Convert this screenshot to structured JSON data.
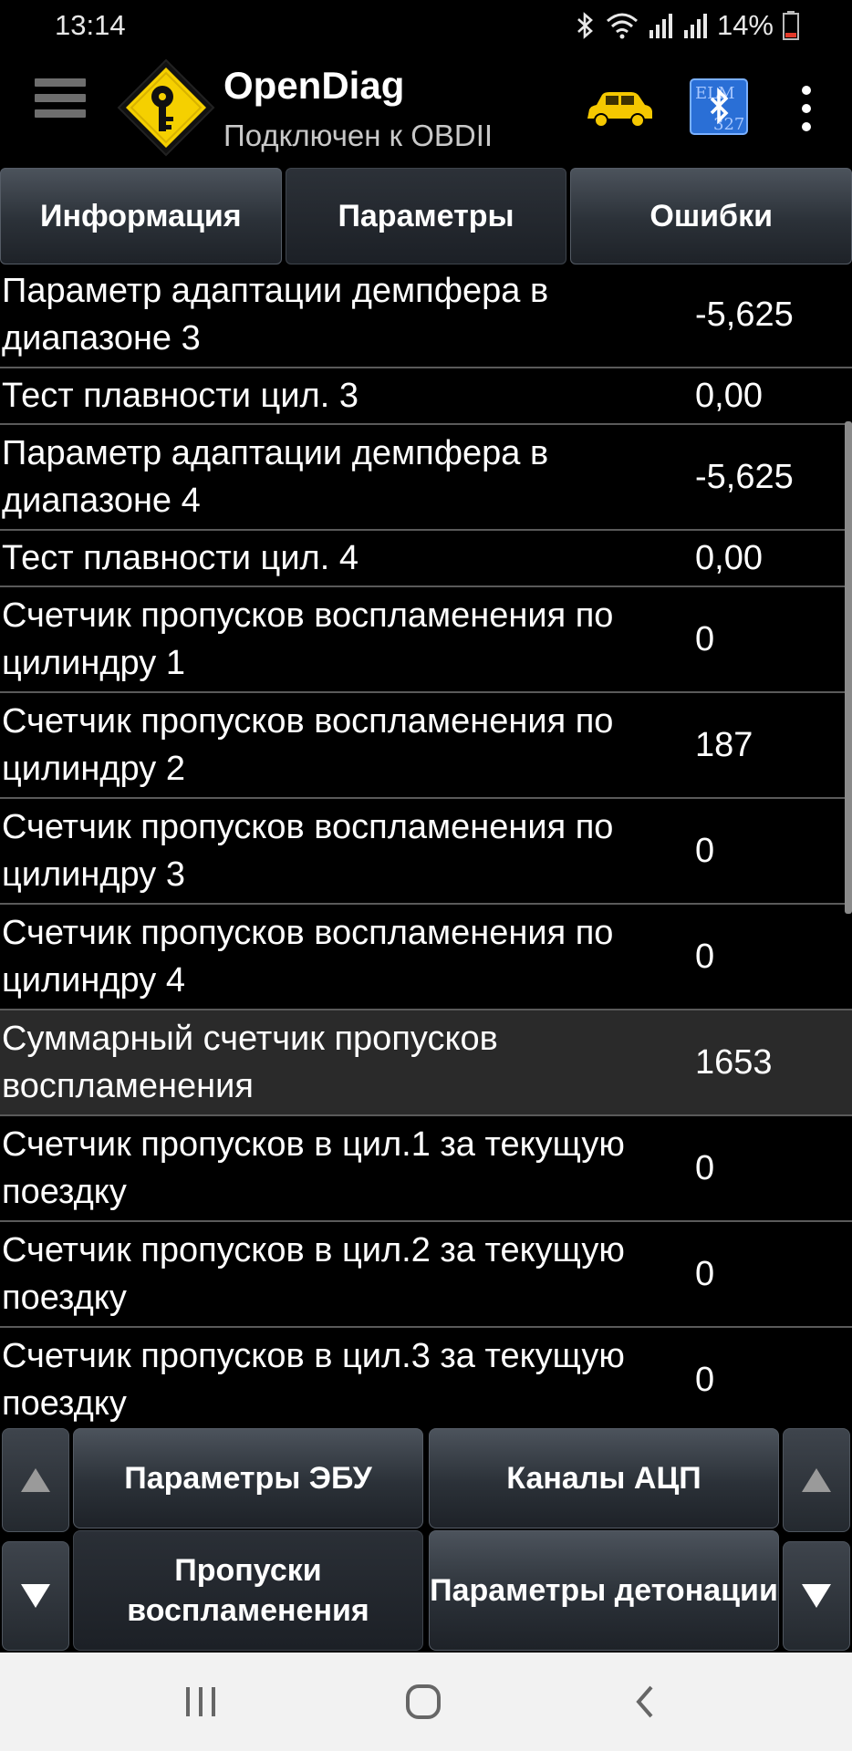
{
  "status_bar": {
    "time": "13:14",
    "battery": "14%"
  },
  "app": {
    "title": "OpenDiag",
    "subtitle": "Подключен к OBDII"
  },
  "tabs": [
    {
      "label": "Информация",
      "active": false
    },
    {
      "label": "Параметры",
      "active": true
    },
    {
      "label": "Ошибки",
      "active": false
    }
  ],
  "params": [
    {
      "name": "Параметр адаптации демпфера в диапазоне 3",
      "value": "-5,625"
    },
    {
      "name": "Тест плавности цил. 3",
      "value": "0,00"
    },
    {
      "name": "Параметр адаптации демпфера в диапазоне 4",
      "value": "-5,625"
    },
    {
      "name": "Тест плавности цил. 4",
      "value": "0,00"
    },
    {
      "name": "Счетчик пропусков воспламенения по цилиндру 1",
      "value": "0"
    },
    {
      "name": "Счетчик пропусков воспламенения по цилиндру 2",
      "value": "187"
    },
    {
      "name": "Счетчик пропусков воспламенения по цилиндру 3",
      "value": "0"
    },
    {
      "name": "Счетчик пропусков воспламенения по цилиндру 4",
      "value": "0"
    },
    {
      "name": "Суммарный счетчик пропусков воспламенения",
      "value": "1653"
    },
    {
      "name": "Счетчик пропусков в цил.1 за текущую поездку",
      "value": "0"
    },
    {
      "name": "Счетчик пропусков в цил.2 за текущую поездку",
      "value": "0"
    },
    {
      "name": "Счетчик пропусков в цил.3 за текущую поездку",
      "value": "0"
    }
  ],
  "bottom_buttons": {
    "ecu_params": "Параметры ЭБУ",
    "adc_channels": "Каналы АЦП",
    "misfires": "Пропуски воспламенения",
    "knock_params": "Параметры детонации"
  },
  "colors": {
    "accent_yellow": "#f5d000",
    "bluetooth_blue": "#2a6fd6",
    "background": "#000000"
  }
}
